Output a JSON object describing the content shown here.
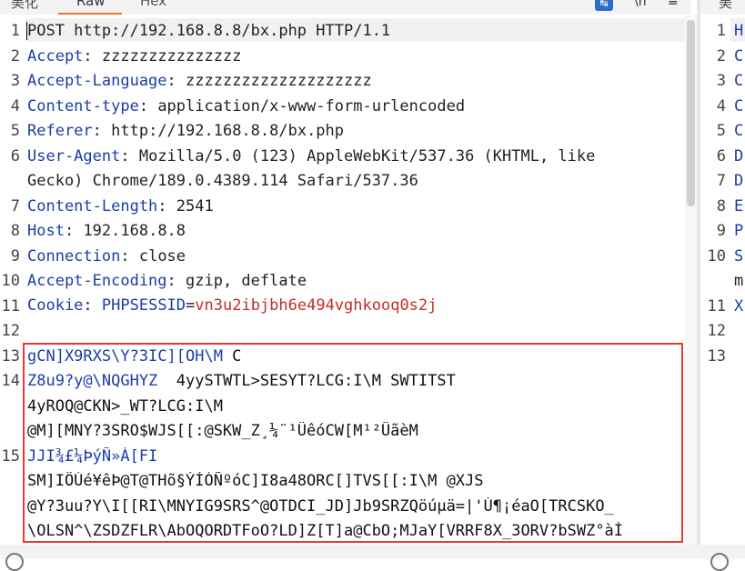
{
  "tabs": {
    "pretty": "美化",
    "raw": "Raw",
    "hex": "Hex"
  },
  "right_tabs": {
    "pretty": "美化"
  },
  "toolbar_icons": [
    "send-icon",
    "newline-icon",
    "menu-icon"
  ],
  "gutter": [
    "1",
    "2",
    "3",
    "4",
    "5",
    "6",
    "",
    "7",
    "8",
    "9",
    "10",
    "11",
    "12",
    "13",
    "14",
    "",
    "",
    "15",
    "",
    "",
    ""
  ],
  "request": {
    "request_line": "POST http://192.168.8.8/bx.php HTTP/1.1",
    "headers": [
      {
        "name": "Accept",
        "sep": ": ",
        "value": "zzzzzzzzzzzzzzz"
      },
      {
        "name": "Accept-Language",
        "sep": ": ",
        "value": "zzzzzzzzzzzzzzzzzzzz"
      },
      {
        "name": "Content-type",
        "sep": ": ",
        "value": "application/x-www-form-urlencoded"
      },
      {
        "name": "Referer",
        "sep": ": ",
        "value": "http://192.168.8.8/bx.php"
      },
      {
        "name": "User-Agent",
        "sep": ": ",
        "value": "Mozilla/5.0 (123) AppleWebKit/537.36 (KHTML, like"
      },
      {
        "name": "",
        "sep": "",
        "value": "Gecko) Chrome/189.0.4389.114 Safari/537.36"
      },
      {
        "name": "Content-Length",
        "sep": ": ",
        "value": "2541"
      },
      {
        "name": "Host",
        "sep": ": ",
        "value": "192.168.8.8"
      },
      {
        "name": "Connection",
        "sep": ": ",
        "value": "close"
      },
      {
        "name": "Accept-Encoding",
        "sep": ": ",
        "value": "gzip, deflate"
      }
    ],
    "cookie": {
      "name": "Cookie",
      "sep": ": ",
      "key": "PHPSESSID",
      "eq": "=",
      "value": "vn3u2ibjbh6e494vghkooq0s2j"
    },
    "body": [
      {
        "cls": "body-blue",
        "a": "gCN]X9RXS\\Y?3IC][OH\\M",
        "b": " C"
      },
      {
        "cls": "body-blue",
        "a": "Z8u9?y@\\NQGHYZ",
        "b": "  4yySTWTL>SESYT?LCG:I\\M SWTITST"
      },
      {
        "cls": "body-dark",
        "a": "4yROQ@CKN>_WT?LCG:I\\M",
        "b": ""
      },
      {
        "cls": "body-dark",
        "a": "@M][MNY?3SRO$WJS[[:@SKW_Z¸¼¨¹ÜêóCW[M¹²ÜãèM",
        "b": ""
      },
      {
        "cls": "body-blue",
        "a": "JJI¾£¼ÞýÑ»Á[FI",
        "b": ""
      },
      {
        "cls": "body-dark",
        "a": "SM]IÖÚé¥êÞ@T@THõ§ÝÍÒÑºóC]I8a48ORC[]TVS[[:I\\M @XJS",
        "b": ""
      },
      {
        "cls": "body-dark",
        "a": "@Y?3uu?Y\\I[[RI\\MNYIG9SRS^@OTDCI_JD]Jb9SRZQöúµä=|'Ú¶¡éaO[TRCSKO_",
        "b": ""
      },
      {
        "cls": "body-dark",
        "a": "\\OLSN^\\ZSDZFLR\\AbOQORDTFoO?LD]Z[T]a@CbO;MJaY[VRRF8X_3ORV?bSWZ°àÍ",
        "b": ""
      }
    ]
  },
  "response_preview": {
    "lines": [
      "H",
      "C",
      "C",
      "C",
      "C",
      "D",
      "D",
      "E",
      "P",
      "S",
      "m",
      "X",
      "",
      ""
    ],
    "gutter": [
      "1",
      "2",
      "3",
      "4",
      "5",
      "6",
      "7",
      "8",
      "9",
      "10",
      "",
      "11",
      "12",
      "13"
    ]
  },
  "colors": {
    "highlight": "#e53935",
    "header_name": "#1a3ea8",
    "cookie_value": "#c22e24",
    "tab_accent": "#e8782b"
  }
}
